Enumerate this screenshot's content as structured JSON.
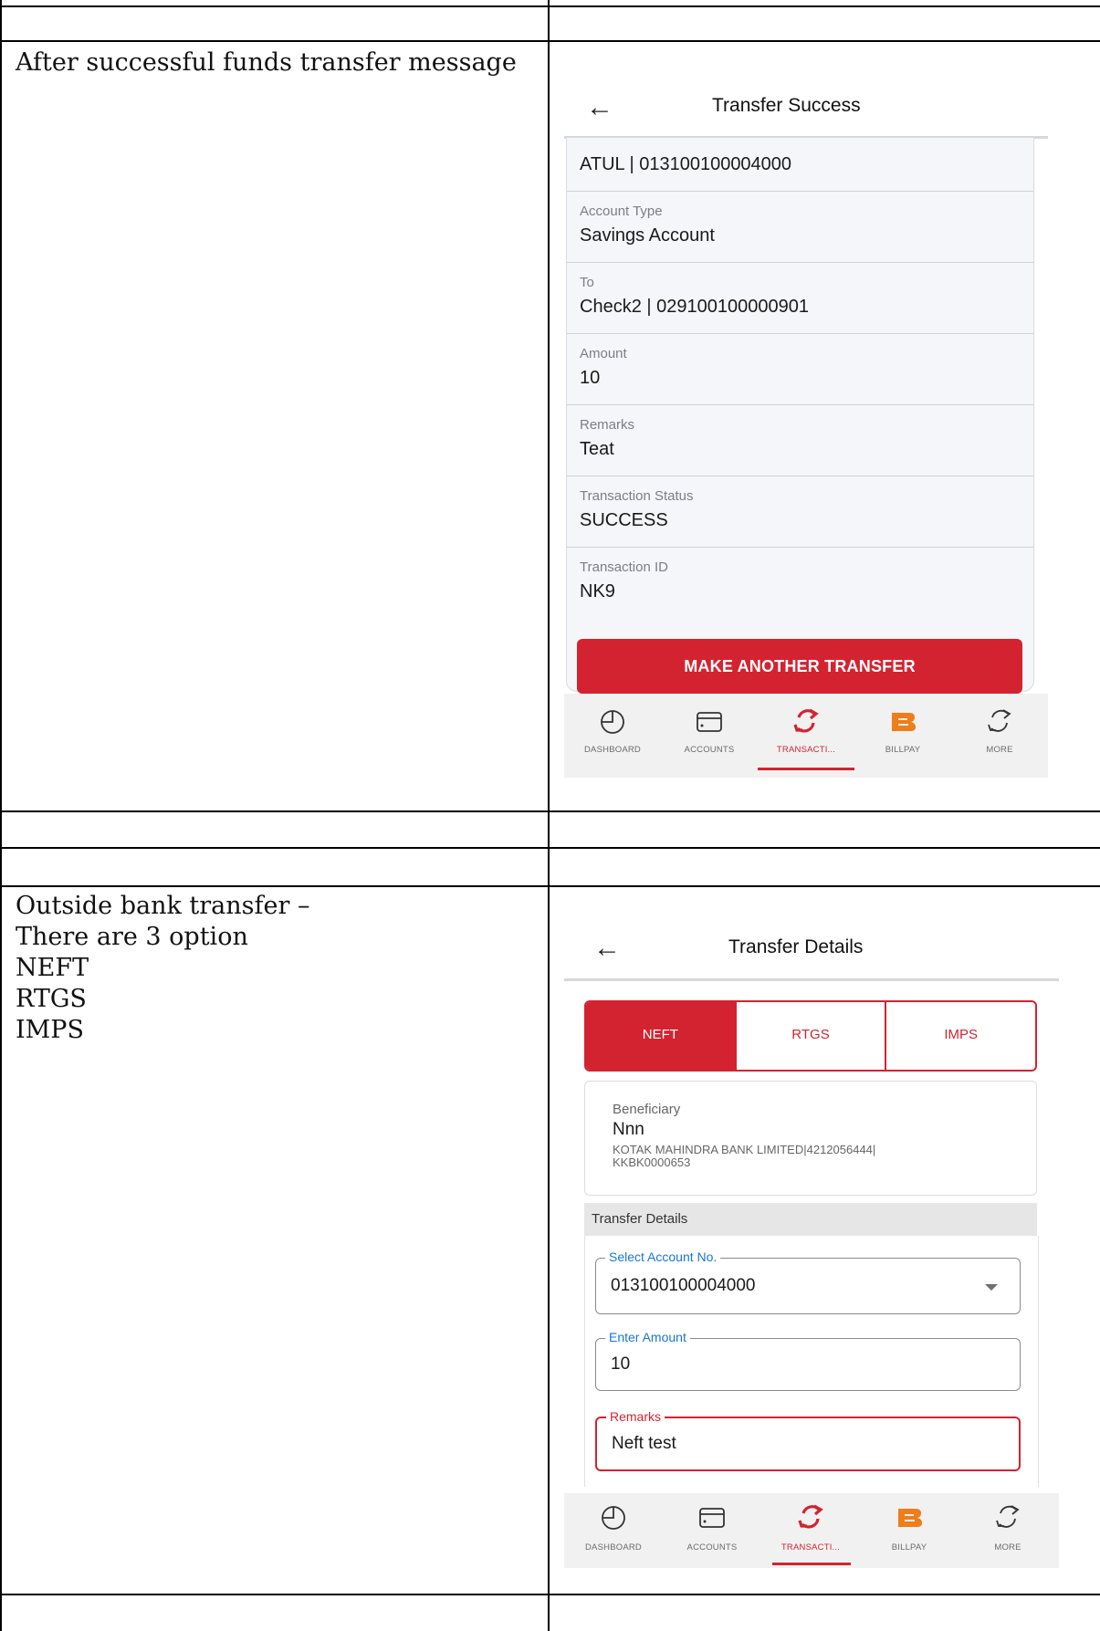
{
  "descriptions": {
    "row1": [
      "After successful funds transfer message"
    ],
    "row2": [
      "Outside bank transfer –",
      "There are 3 option",
      "NEFT",
      "RTGS",
      "IMPS"
    ]
  },
  "screen1": {
    "title": "Transfer Success",
    "account_summary": "ATUL | 013100100004000",
    "rows": [
      {
        "label": "Account Type",
        "value": "Savings Account"
      },
      {
        "label": "To",
        "value": "Check2 | 029100100000901"
      },
      {
        "label": "Amount",
        "value": "10"
      },
      {
        "label": "Remarks",
        "value": "Teat"
      },
      {
        "label": "Transaction Status",
        "value": "SUCCESS"
      },
      {
        "label": "Transaction ID",
        "value": "NK9"
      }
    ],
    "button_label": "MAKE ANOTHER TRANSFER"
  },
  "screen2": {
    "title": "Transfer Details",
    "tabs": [
      {
        "label": "NEFT",
        "active": true
      },
      {
        "label": "RTGS",
        "active": false
      },
      {
        "label": "IMPS",
        "active": false
      }
    ],
    "beneficiary": {
      "label": "Beneficiary",
      "name": "Nnn",
      "detail_line1": "KOTAK MAHINDRA BANK LIMITED|4212056444|",
      "detail_line2": "KKBK0000653"
    },
    "section_title": "Transfer Details",
    "fields": {
      "account": {
        "label": "Select Account No.",
        "value": "013100100004000"
      },
      "amount": {
        "label": "Enter Amount",
        "value": "10"
      },
      "remarks": {
        "label": "Remarks",
        "value": "Neft test"
      }
    }
  },
  "bottom_nav": {
    "items": [
      {
        "label": "DASHBOARD",
        "icon": "pie-chart-icon"
      },
      {
        "label": "ACCOUNTS",
        "icon": "wallet-icon"
      },
      {
        "label": "TRANSACTI...",
        "icon": "transfer-arrows-icon",
        "active": true
      },
      {
        "label": "BILLPAY",
        "icon": "billpay-b-icon"
      },
      {
        "label": "MORE",
        "icon": "more-arrows-icon"
      }
    ]
  },
  "colors": {
    "accent": "#d32330",
    "billpay": "#ef7d1a",
    "legend_blue": "#1976d2"
  }
}
